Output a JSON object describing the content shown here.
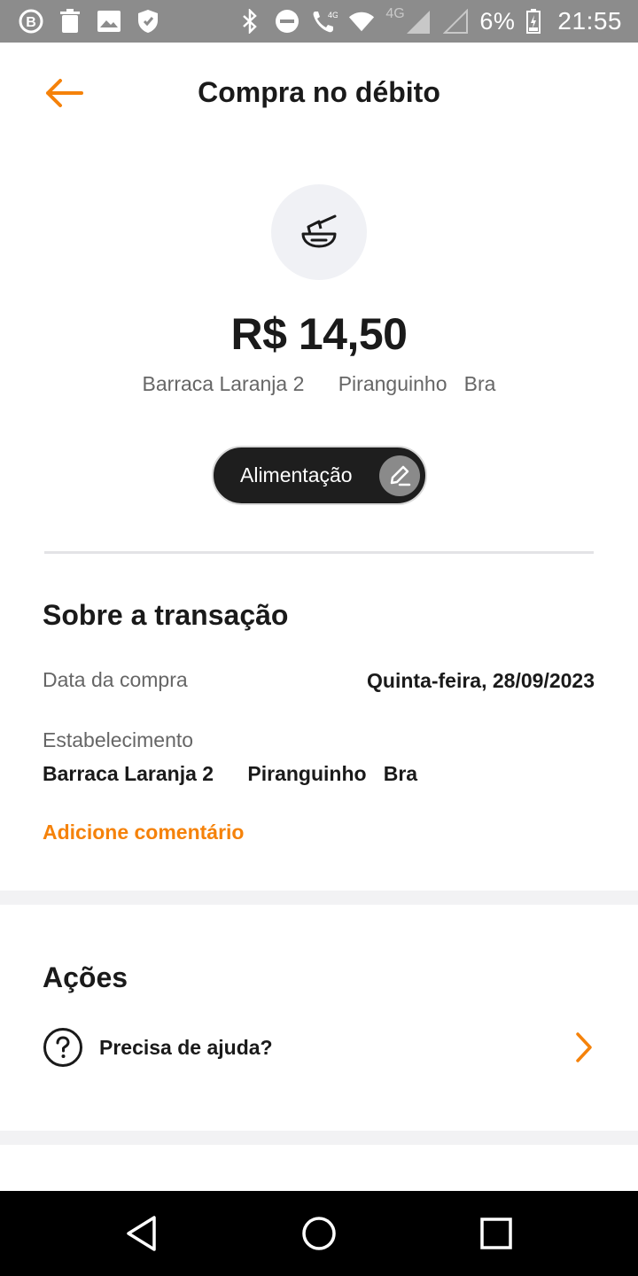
{
  "status_bar": {
    "battery": "6%",
    "time": "21:55",
    "network_label_1": "4G",
    "network_label_2": "4G",
    "icons_left": [
      "b-notification-icon",
      "trash-icon",
      "image-icon",
      "shield-icon"
    ],
    "icons_right": [
      "bluetooth-icon",
      "dnd-icon",
      "wifi-call-icon",
      "wifi-icon",
      "signal-icon",
      "signal-icon",
      "battery-icon"
    ]
  },
  "header": {
    "title": "Compra no débito",
    "back_icon": "arrow-left-icon"
  },
  "transaction": {
    "category_icon": "bowl-icon",
    "amount": "R$ 14,50",
    "merchant_line": "Barraca Laranja 2      Piranguinho   Bra",
    "category_label": "Alimentação",
    "category_edit_icon": "pencil-icon"
  },
  "about": {
    "title": "Sobre a transação",
    "date_label": "Data da compra",
    "date_value": "Quinta-feira, 28/09/2023",
    "establishment_label": "Estabelecimento",
    "establishment_value": "Barraca Laranja 2      Piranguinho   Bra",
    "add_comment": "Adicione comentário"
  },
  "actions": {
    "title": "Ações",
    "help_label": "Precisa de ajuda?",
    "help_icon": "question-circle-icon",
    "chevron_icon": "chevron-right-icon"
  },
  "colors": {
    "accent": "#f5820a",
    "chip_bg": "#1e1e1e",
    "status_bar": "#8c8c8c"
  },
  "nav_bar": {
    "buttons": [
      "back-triangle-icon",
      "home-circle-icon",
      "recents-square-icon"
    ]
  }
}
